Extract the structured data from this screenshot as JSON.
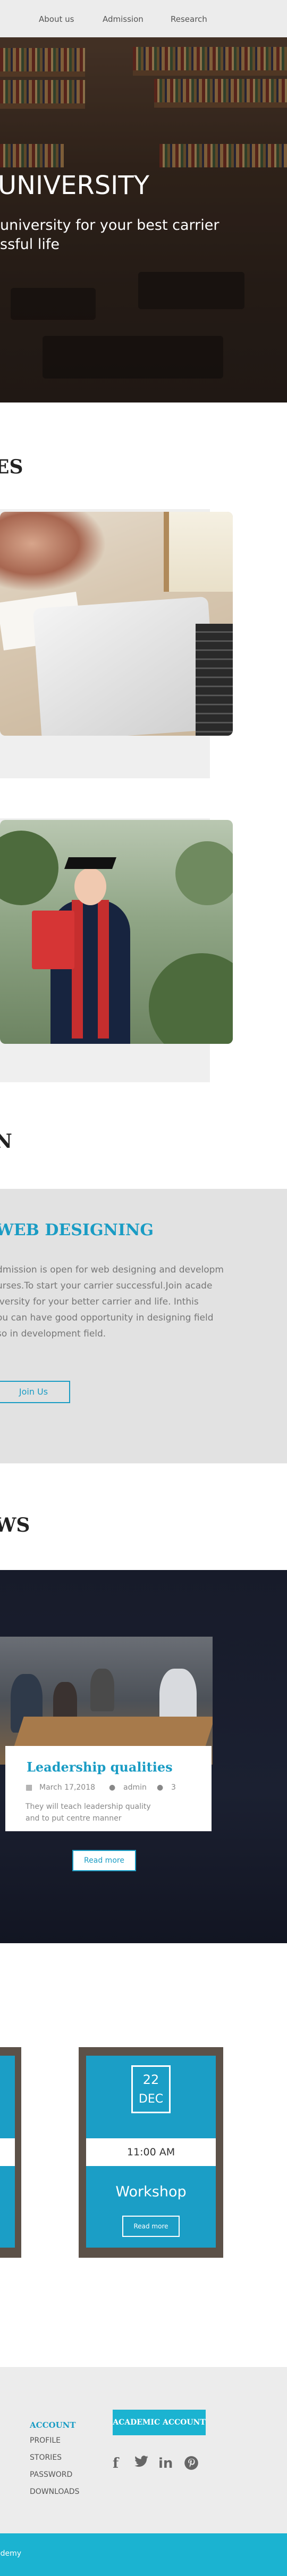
{
  "nav": {
    "items": [
      "About us",
      "Admission",
      "Research"
    ]
  },
  "hero": {
    "title": "UNIVERSITY",
    "subtitle_line1": "university for your best carrier",
    "subtitle_line2": "ssful life"
  },
  "sections": {
    "courses_heading": "ES",
    "admission_heading": "N",
    "news_heading": "WS"
  },
  "course": {
    "title": "WEB DESIGNING",
    "text_lines": [
      "dmission is open for web designing and developm",
      "urses.To start your carrier successful.Join acade",
      "iversity for your better carrier and life. Inthis",
      "ou can have good opportunity in designing field",
      "so in development field."
    ],
    "button": "Join Us"
  },
  "news": {
    "title": "Leadership qualities",
    "date": "March 17,2018",
    "author": "admin",
    "comments": "3",
    "desc_line1": "They will teach leadership quality",
    "desc_line2": "and to put centre manner",
    "button": "Read more"
  },
  "event": {
    "day": "22",
    "month": "DEC",
    "time": "11:00 AM",
    "title": "Workshop",
    "button": "Read more"
  },
  "footer": {
    "heading": "ACCOUNT",
    "links": [
      "PROFILE",
      "STORIES",
      "PASSWORD",
      "DOWNLOADS"
    ],
    "account_button": "ACADEMIC ACCOUNT",
    "social_icons": [
      "facebook-icon",
      "twitter-icon",
      "linkedin-icon",
      "pinterest-icon"
    ],
    "copyright": "ademy"
  },
  "colors": {
    "accent": "#1a9cc4",
    "bar": "#1bb3d1"
  }
}
